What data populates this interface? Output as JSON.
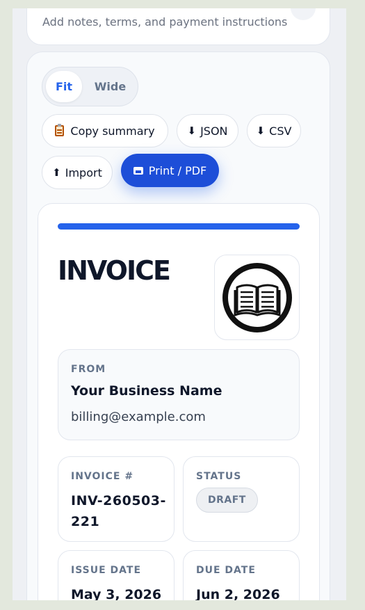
{
  "notes": {
    "placeholder": "Add notes, terms, and payment instructions"
  },
  "view_toggle": {
    "fit_label": "Fit",
    "wide_label": "Wide",
    "selected": "Fit"
  },
  "actions": {
    "copy_summary_label": "Copy summary",
    "json_label": "JSON",
    "csv_label": "CSV",
    "import_label": "Import",
    "print_label": "Print / PDF"
  },
  "icons": {
    "copy": "clipboard-icon",
    "json": "download-arrow-icon",
    "csv": "download-arrow-icon",
    "import": "upload-arrow-icon",
    "print": "printer-icon",
    "logo": "open-book-icon"
  },
  "colors": {
    "accent": "#2563eb",
    "primary_button": "#1d4ed8",
    "muted_label": "#64748b"
  },
  "invoice": {
    "title": "INVOICE",
    "from": {
      "label": "FROM",
      "name": "Your Business Name",
      "email": "billing@example.com"
    },
    "number": {
      "label": "INVOICE #",
      "value": "INV-260503-221"
    },
    "status": {
      "label": "STATUS",
      "value": "DRAFT"
    },
    "issue_date": {
      "label": "ISSUE DATE",
      "value": "May 3, 2026"
    },
    "due_date": {
      "label": "DUE DATE",
      "value": "Jun 2, 2026"
    }
  }
}
